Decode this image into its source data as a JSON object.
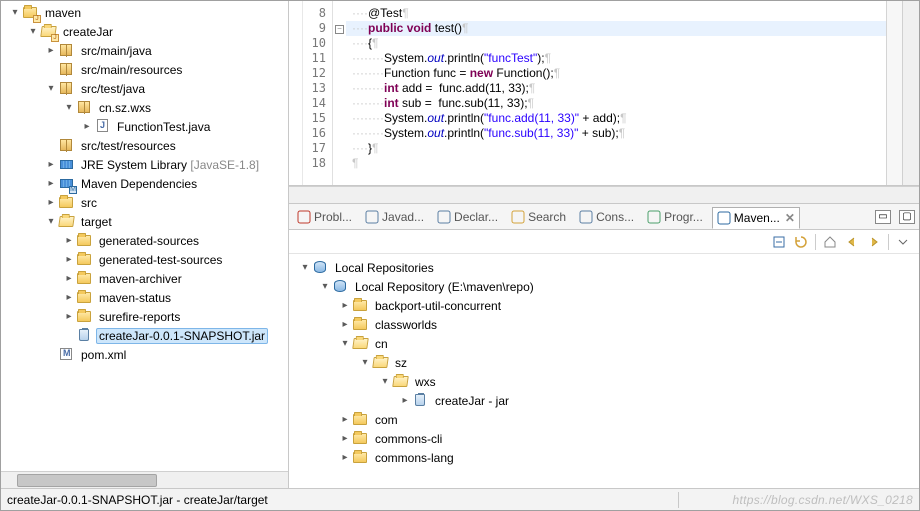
{
  "project_tree": {
    "root": "maven",
    "items": [
      {
        "indent": 0,
        "tw": "▾",
        "icon": "folder-j",
        "label": "maven"
      },
      {
        "indent": 1,
        "tw": "▾",
        "icon": "folder-open-j",
        "label": "createJar"
      },
      {
        "indent": 2,
        "tw": "▸",
        "icon": "pkg",
        "label": "src/main/java"
      },
      {
        "indent": 2,
        "tw": "",
        "icon": "pkg",
        "label": "src/main/resources"
      },
      {
        "indent": 2,
        "tw": "▾",
        "icon": "pkg",
        "label": "src/test/java"
      },
      {
        "indent": 3,
        "tw": "▾",
        "icon": "pkg",
        "label": "cn.sz.wxs"
      },
      {
        "indent": 4,
        "tw": "▸",
        "icon": "java",
        "label": "FunctionTest.java"
      },
      {
        "indent": 2,
        "tw": "",
        "icon": "pkg",
        "label": "src/test/resources"
      },
      {
        "indent": 2,
        "tw": "▸",
        "icon": "lib",
        "label": "JRE System Library ",
        "suffix": "[JavaSE-1.8]"
      },
      {
        "indent": 2,
        "tw": "▸",
        "icon": "lib-m",
        "label": "Maven Dependencies"
      },
      {
        "indent": 2,
        "tw": "▸",
        "icon": "folder",
        "label": "src"
      },
      {
        "indent": 2,
        "tw": "▾",
        "icon": "folder-open",
        "label": "target"
      },
      {
        "indent": 3,
        "tw": "▸",
        "icon": "folder",
        "label": "generated-sources"
      },
      {
        "indent": 3,
        "tw": "▸",
        "icon": "folder",
        "label": "generated-test-sources"
      },
      {
        "indent": 3,
        "tw": "▸",
        "icon": "folder",
        "label": "maven-archiver"
      },
      {
        "indent": 3,
        "tw": "▸",
        "icon": "folder",
        "label": "maven-status"
      },
      {
        "indent": 3,
        "tw": "▸",
        "icon": "folder",
        "label": "surefire-reports"
      },
      {
        "indent": 3,
        "tw": "",
        "icon": "jar",
        "label": "createJar-0.0.1-SNAPSHOT.jar",
        "selected": true
      },
      {
        "indent": 2,
        "tw": "",
        "icon": "xwin",
        "label": "pom.xml"
      }
    ]
  },
  "editor": {
    "first_line_no": 8,
    "lines": [
      {
        "raw": "    @Test"
      },
      {
        "raw": "    public void test()",
        "hl": true
      },
      {
        "raw": "    {"
      },
      {
        "raw": "        System.out.println(\"funcTest\");"
      },
      {
        "raw": "        Function func = new Function();"
      },
      {
        "raw": "        int add =  func.add(11, 33);"
      },
      {
        "raw": "        int sub =  func.sub(11, 33);"
      },
      {
        "raw": "        System.out.println(\"func.add(11, 33)\" + add);"
      },
      {
        "raw": "        System.out.println(\"func.sub(11, 33)\" + sub);"
      },
      {
        "raw": "    }"
      },
      {
        "raw": ""
      }
    ]
  },
  "bottom_tabs": [
    {
      "icon": "probl",
      "label": "Probl...",
      "color": "#c0392b"
    },
    {
      "icon": "javad",
      "label": "Javad...",
      "color": "#5b7ea3"
    },
    {
      "icon": "declar",
      "label": "Declar...",
      "color": "#5b7ea3"
    },
    {
      "icon": "search",
      "label": "Search",
      "color": "#d4a23a"
    },
    {
      "icon": "cons",
      "label": "Cons...",
      "color": "#5b7ea3"
    },
    {
      "icon": "progr",
      "label": "Progr...",
      "color": "#4aa06a"
    },
    {
      "icon": "maven",
      "label": "Maven...",
      "active": true,
      "color": "#2c6aa0",
      "closable": true
    }
  ],
  "repo_tree": [
    {
      "indent": 0,
      "tw": "▾",
      "icon": "db",
      "label": "Local Repositories"
    },
    {
      "indent": 1,
      "tw": "▾",
      "icon": "db",
      "label": "Local Repository (E:\\maven\\repo)"
    },
    {
      "indent": 2,
      "tw": "▸",
      "icon": "folder",
      "label": "backport-util-concurrent"
    },
    {
      "indent": 2,
      "tw": "▸",
      "icon": "folder",
      "label": "classworlds"
    },
    {
      "indent": 2,
      "tw": "▾",
      "icon": "folder-open",
      "label": "cn"
    },
    {
      "indent": 3,
      "tw": "▾",
      "icon": "folder-open",
      "label": "sz"
    },
    {
      "indent": 4,
      "tw": "▾",
      "icon": "folder-open",
      "label": "wxs"
    },
    {
      "indent": 5,
      "tw": "▸",
      "icon": "jar",
      "label": "createJar - jar"
    },
    {
      "indent": 2,
      "tw": "▸",
      "icon": "folder",
      "label": "com"
    },
    {
      "indent": 2,
      "tw": "▸",
      "icon": "folder",
      "label": "commons-cli"
    },
    {
      "indent": 2,
      "tw": "▸",
      "icon": "folder",
      "label": "commons-lang"
    }
  ],
  "toolbar_icons": [
    "collapse",
    "refresh",
    "sep",
    "home",
    "back",
    "forward",
    "sep",
    "menu"
  ],
  "status": {
    "text": "createJar-0.0.1-SNAPSHOT.jar - createJar/target",
    "watermark": "https://blog.csdn.net/WXS_0218"
  }
}
